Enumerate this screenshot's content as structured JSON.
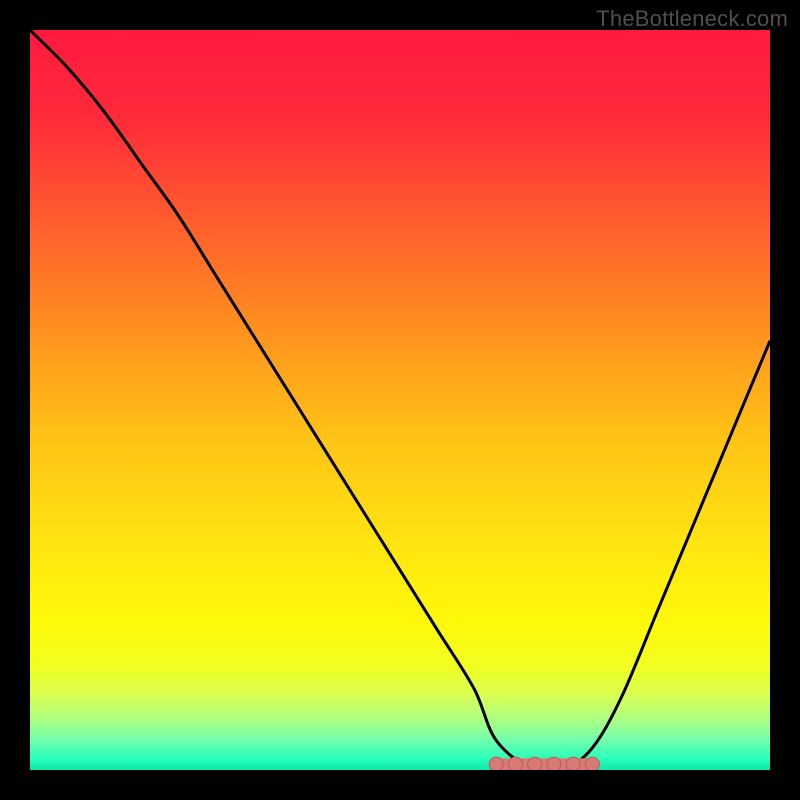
{
  "watermark": "TheBottleneck.com",
  "colors": {
    "frame": "#000000",
    "gradient_stops": [
      {
        "offset": 0.0,
        "color": "#ff1a3e"
      },
      {
        "offset": 0.12,
        "color": "#ff2a3a"
      },
      {
        "offset": 0.25,
        "color": "#ff5a2f"
      },
      {
        "offset": 0.4,
        "color": "#ff8f1f"
      },
      {
        "offset": 0.55,
        "color": "#ffc316"
      },
      {
        "offset": 0.7,
        "color": "#ffe610"
      },
      {
        "offset": 0.8,
        "color": "#fff90a"
      },
      {
        "offset": 0.86,
        "color": "#f0ff20"
      },
      {
        "offset": 0.9,
        "color": "#d8ff55"
      },
      {
        "offset": 0.93,
        "color": "#b0ff80"
      },
      {
        "offset": 0.96,
        "color": "#70ffad"
      },
      {
        "offset": 0.985,
        "color": "#28ffbe"
      },
      {
        "offset": 1.0,
        "color": "#0fe8a8"
      }
    ],
    "curve": "#000000",
    "marker_fill": "#d77a73",
    "marker_stroke": "#b85f57"
  },
  "chart_data": {
    "type": "line",
    "title": "",
    "xlabel": "",
    "ylabel": "",
    "xlim": [
      0,
      100
    ],
    "ylim": [
      0,
      100
    ],
    "x": [
      0,
      5,
      10,
      15,
      20,
      25,
      30,
      35,
      40,
      45,
      50,
      55,
      60,
      63,
      68,
      72,
      76,
      80,
      85,
      90,
      95,
      100
    ],
    "values": [
      100,
      95,
      89,
      82,
      75,
      67,
      59,
      51,
      43,
      35,
      27,
      19,
      11,
      4,
      0,
      0,
      3,
      10,
      22,
      34,
      46,
      58
    ],
    "marker_segment": {
      "x0": 63,
      "x1": 76,
      "y": 0
    }
  }
}
